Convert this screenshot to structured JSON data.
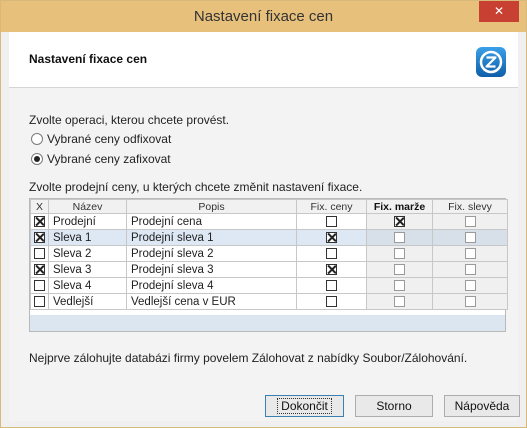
{
  "window": {
    "title": "Nastavení fixace cen",
    "close_glyph": "✕"
  },
  "header": {
    "title": "Nastavení fixace cen",
    "logo_icon": "app-logo-icon"
  },
  "operation": {
    "prompt": "Zvolte operaci, kterou chcete provést.",
    "options": [
      {
        "label": "Vybrané ceny odfixovat",
        "selected": false
      },
      {
        "label": "Vybrané ceny zafixovat",
        "selected": true
      }
    ]
  },
  "prices": {
    "prompt": "Zvolte prodejní ceny, u kterých chcete změnit nastavení fixace.",
    "columns": [
      "X",
      "Název",
      "Popis",
      "Fix. ceny",
      "Fix. marže",
      "Fix. slevy"
    ],
    "rows": [
      {
        "x": true,
        "nazev": "Prodejní",
        "popis": "Prodejní cena",
        "fix_ceny": false,
        "fix_marze": true,
        "fix_slevy": false
      },
      {
        "x": true,
        "nazev": "Sleva 1",
        "popis": "Prodejní sleva 1",
        "fix_ceny": true,
        "fix_marze": false,
        "fix_slevy": false
      },
      {
        "x": false,
        "nazev": "Sleva 2",
        "popis": "Prodejní sleva 2",
        "fix_ceny": false,
        "fix_marze": false,
        "fix_slevy": false
      },
      {
        "x": true,
        "nazev": "Sleva 3",
        "popis": "Prodejní sleva 3",
        "fix_ceny": true,
        "fix_marze": false,
        "fix_slevy": false
      },
      {
        "x": false,
        "nazev": "Sleva 4",
        "popis": "Prodejní sleva 4",
        "fix_ceny": false,
        "fix_marze": false,
        "fix_slevy": false
      },
      {
        "x": false,
        "nazev": "Vedlejší",
        "popis": "Vedlejší cena v EUR",
        "fix_ceny": false,
        "fix_marze": false,
        "fix_slevy": false
      }
    ]
  },
  "note": "Nejprve zálohujte databázi firmy povelem Zálohovat z nabídky Soubor/Zálohování.",
  "buttons": {
    "finish": "Dokončit",
    "cancel": "Storno",
    "help": "Nápověda"
  },
  "colors": {
    "titlebar": "#e7c07c",
    "close": "#c84031",
    "accent": "#1b78c9"
  }
}
